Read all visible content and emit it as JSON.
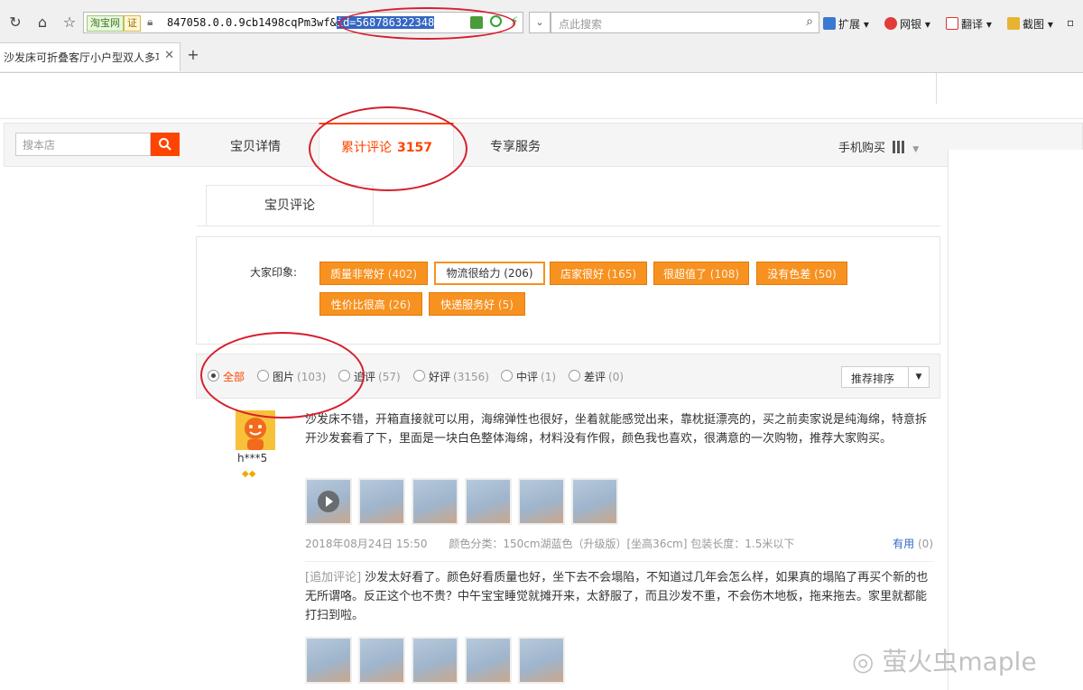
{
  "browser": {
    "url_badge_site": "淘宝网",
    "url_badge_cert": "证",
    "url_prefix": "847058.0.0.9cb1498cqPm3wf&",
    "url_selected": "id=568786322348",
    "search_placeholder": "点此搜索",
    "tools": [
      {
        "label": "扩展",
        "icon": "extensions-icon"
      },
      {
        "label": "网银",
        "icon": "bank-icon"
      },
      {
        "label": "翻译",
        "icon": "translate-icon"
      },
      {
        "label": "截图",
        "icon": "screenshot-icon"
      }
    ],
    "tab_title": "沙发床可折叠客厅小户型双人多功能",
    "colors": {
      "selection": "#3467c3"
    }
  },
  "shop": {
    "search_placeholder": "搜本店",
    "tabs": {
      "details": "宝贝详情",
      "reviews_label": "累计评论",
      "reviews_count": "3157",
      "service": "专享服务"
    },
    "mobile_buy": "手机购买",
    "accent": "#ff4400"
  },
  "reviews": {
    "subtab": "宝贝评论",
    "impressions_label": "大家印象:",
    "tags": [
      {
        "text": "质量非常好",
        "count": "(402)"
      },
      {
        "text": "物流很给力",
        "count": "(206)"
      },
      {
        "text": "店家很好",
        "count": "(165)"
      },
      {
        "text": "很超值了",
        "count": "(108)"
      },
      {
        "text": "没有色差",
        "count": "(50)"
      },
      {
        "text": "性价比很高",
        "count": "(26)"
      },
      {
        "text": "快递服务好",
        "count": "(5)"
      }
    ],
    "filters": [
      {
        "label": "全部",
        "count": ""
      },
      {
        "label": "图片",
        "count": "(103)"
      },
      {
        "label": "追评",
        "count": "(57)"
      },
      {
        "label": "好评",
        "count": "(3156)"
      },
      {
        "label": "中评",
        "count": "(1)"
      },
      {
        "label": "差评",
        "count": "(0)"
      }
    ],
    "sort_label": "推荐排序",
    "tag_color": "#f7911f"
  },
  "review": {
    "username": "h***5",
    "rank": "◆◆",
    "text": "沙发床不错，开箱直接就可以用，海绵弹性也很好，坐着就能感觉出来，靠枕挺漂亮的，买之前卖家说是纯海绵，特意拆开沙发套看了下，里面是一块白色整体海绵，材料没有作假，颜色我也喜欢，很满意的一次购物，推荐大家购买。",
    "date": "2018年08月24日 15:50",
    "sku": "颜色分类：150cm湖蓝色（升级版）[坐高36cm] 包装长度：1.5米以下",
    "useful_label": "有用",
    "useful_count": "(0)",
    "append_tag": "[追加评论]",
    "append_text": "沙发太好看了。颜色好看质量也好，坐下去不会塌陷，不知道过几年会怎么样，如果真的塌陷了再买个新的也无所谓咯。反正这个也不贵？中午宝宝睡觉就摊开来，太舒服了，而且沙发不重，不会伤木地板，拖来拖去。家里就都能打扫到啦。"
  },
  "watermark": "萤火虫maple",
  "annotation_color": "#d61f2c"
}
